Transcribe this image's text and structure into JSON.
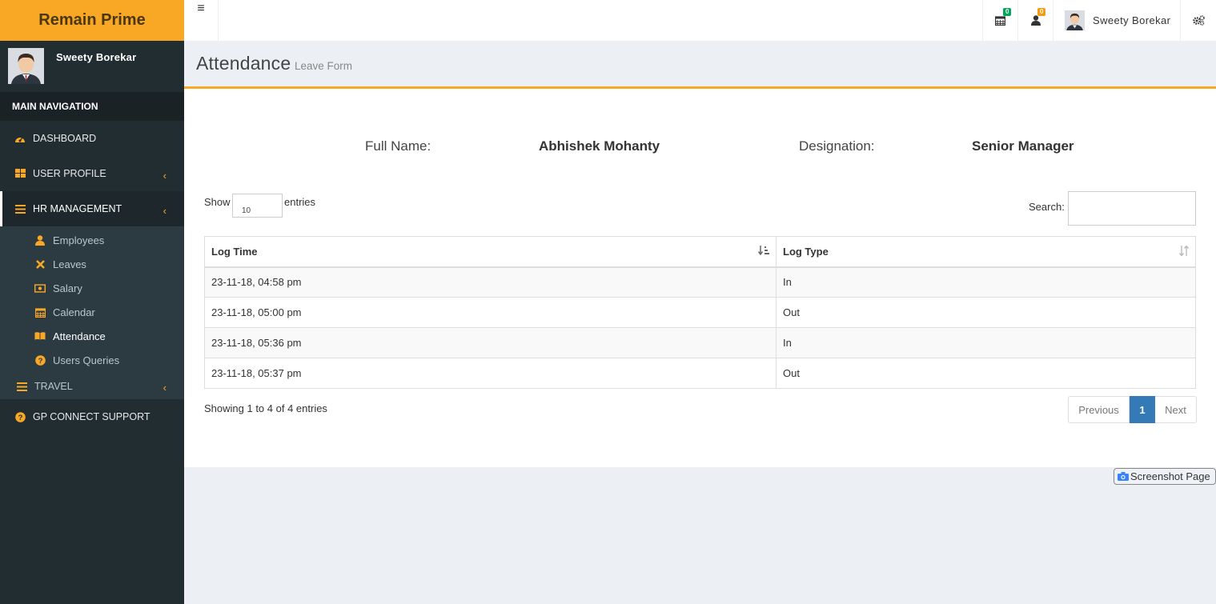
{
  "app": {
    "logo": "Remain Prime"
  },
  "sidebar": {
    "user_name": "Sweety Borekar",
    "nav_header": "MAIN NAVIGATION",
    "items": [
      {
        "label": "DASHBOARD",
        "icon": "dashboard-icon"
      },
      {
        "label": "USER PROFILE",
        "icon": "th-large-icon"
      },
      {
        "label": "HR MANAGEMENT",
        "icon": "bars-icon"
      }
    ],
    "hr_sub": [
      {
        "label": "Employees",
        "icon": "user-icon"
      },
      {
        "label": "Leaves",
        "icon": "times-icon"
      },
      {
        "label": "Salary",
        "icon": "money-icon"
      },
      {
        "label": "Calendar",
        "icon": "calendar-icon"
      },
      {
        "label": "Attendance",
        "icon": "book-icon"
      },
      {
        "label": "Users Queries",
        "icon": "question-circle-icon"
      }
    ],
    "travel": {
      "label": "TRAVEL",
      "icon": "bars-icon"
    },
    "support": {
      "label": "GP CONNECT SUPPORT",
      "icon": "question-circle-icon"
    }
  },
  "topbar": {
    "toggle_icon": "≡",
    "calendar_badge": "0",
    "user_badge": "0",
    "user_name": "Sweety Borekar"
  },
  "page": {
    "title": "Attendance",
    "subtitle": "Leave Form"
  },
  "employee": {
    "name_label": "Full Name:",
    "name_value": "Abhishek Mohanty",
    "designation_label": "Designation:",
    "designation_value": "Senior Manager"
  },
  "table": {
    "show_label": "Show",
    "entries_label": "entries",
    "length": "10",
    "search_label": "Search:",
    "columns": [
      "Log Time",
      "Log Type"
    ],
    "rows": [
      [
        "23-11-18, 04:58 pm",
        "In"
      ],
      [
        "23-11-18, 05:00 pm",
        "Out"
      ],
      [
        "23-11-18, 05:36 pm",
        "In"
      ],
      [
        "23-11-18, 05:37 pm",
        "Out"
      ]
    ],
    "info": "Showing 1 to 4 of 4 entries",
    "prev": "Previous",
    "page": "1",
    "next": "Next"
  },
  "screenshot_button": "Screenshot Page",
  "colors": {
    "brand": "#f9a825",
    "sidebar": "#222d32",
    "primary": "#337ab7"
  }
}
